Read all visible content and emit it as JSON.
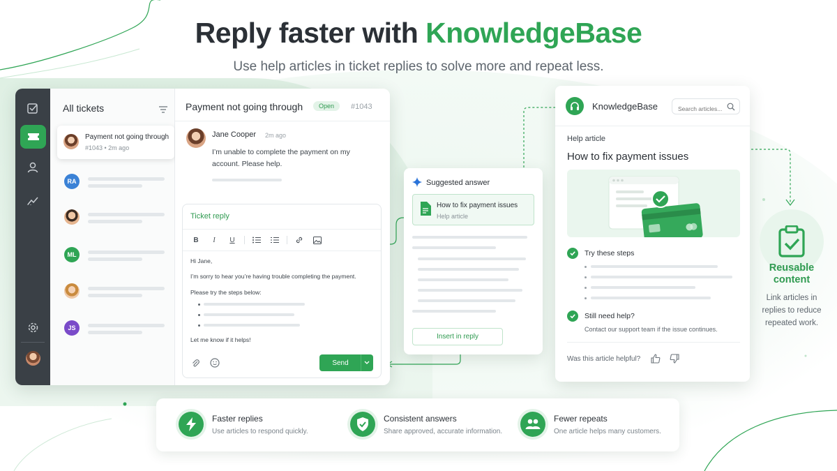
{
  "headline": {
    "title_prefix": "Reply faster with ",
    "title_accent": "KnowledgeBase",
    "subtitle": "Use help articles in ticket replies to solve more and repeat less."
  },
  "colors": {
    "accent": "#2fa555",
    "rail": "#3a4046",
    "text": "#2b3036"
  },
  "rail": {
    "items": [
      {
        "icon": "tasks-icon"
      },
      {
        "icon": "ticket-icon",
        "active": true
      },
      {
        "icon": "user-icon"
      },
      {
        "icon": "analytics-icon"
      }
    ],
    "bottom": [
      {
        "icon": "gear-icon"
      },
      {
        "icon": "avatar"
      }
    ]
  },
  "tickets": {
    "title": "All tickets",
    "selected": {
      "subject": "Payment not going through",
      "meta": "#1043 • 2m ago"
    },
    "rows": [
      {
        "initials": "RA",
        "color": "#3b82d6"
      },
      {
        "avatar": "photo"
      },
      {
        "initials": "ML",
        "color": "#2fa555"
      },
      {
        "avatar": "photo"
      },
      {
        "initials": "JS",
        "color": "#7a4bc9"
      }
    ]
  },
  "conversation": {
    "title": "Payment not going through",
    "status": "Open",
    "ticket_number": "#1043",
    "message": {
      "author": "Jane Cooper",
      "time": "2m ago",
      "text": "I’m unable to complete the payment on my account. Please help."
    },
    "reply": {
      "label": "Ticket reply",
      "toolbar": [
        "B",
        "I",
        "U"
      ],
      "greeting": "Hi Jane,",
      "line1": "I’m sorry to hear you’re having trouble completing the payment.",
      "line2": "Please try the steps below:",
      "closing": "Let me know if it helps!",
      "send_label": "Send"
    }
  },
  "suggested": {
    "title": "Suggested answer",
    "article_title": "How to fix payment issues",
    "article_type": "Help article",
    "insert_label": "Insert in reply"
  },
  "knowledgebase": {
    "name": "KnowledgeBase",
    "search_placeholder": "Search articles...",
    "label": "Help article",
    "title": "How to fix payment issues",
    "step1": "Try these steps",
    "step2": "Still need help?",
    "note": "Contact our support team if the issue continues.",
    "helpful": "Was this article helpful?"
  },
  "reusable": {
    "title": "Reusable content",
    "text": "Link articles in replies to reduce repeated work."
  },
  "features": [
    {
      "icon": "lightning-icon",
      "title": "Faster replies",
      "desc": "Use articles to respond quickly."
    },
    {
      "icon": "shield-check-icon",
      "title": "Consistent answers",
      "desc": "Share approved, accurate information."
    },
    {
      "icon": "users-icon",
      "title": "Fewer repeats",
      "desc": "One article helps many customers."
    }
  ]
}
